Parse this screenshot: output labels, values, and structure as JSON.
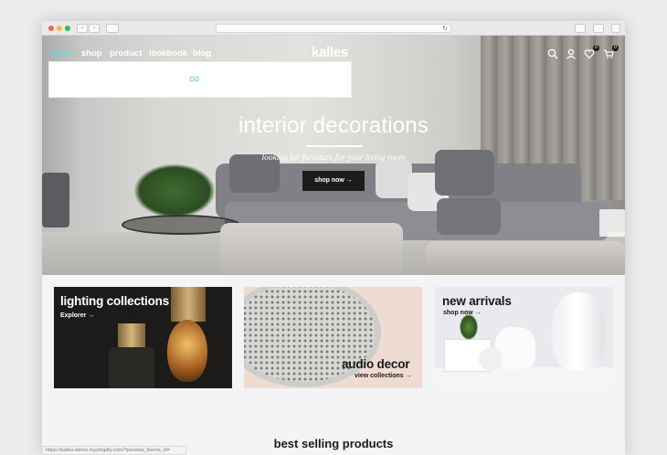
{
  "browser": {
    "url_text": "",
    "status_url": "https://kalles-demo.myshopify.com/?preview_theme_id="
  },
  "header": {
    "logo": "kalles",
    "nav": [
      "demo",
      "shop",
      "product",
      "lookbook",
      "blog"
    ],
    "active_color": "#6fd6e0",
    "wishlist_count": "0",
    "cart_count": "0"
  },
  "hero": {
    "title": "interior decorations",
    "subtitle": "looking for furniture for your living room",
    "button": "shop now →"
  },
  "collections": [
    {
      "title": "lighting collections",
      "link": "Explorer →"
    },
    {
      "title": "audio decor",
      "link": "view collections →"
    },
    {
      "title": "new arrivals",
      "link": "shop now →"
    }
  ],
  "section_title": "best selling products"
}
